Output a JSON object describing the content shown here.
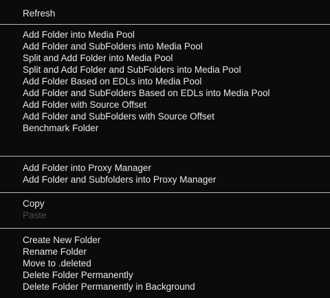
{
  "context_menu": {
    "groups": [
      {
        "items": [
          {
            "label": "Refresh",
            "enabled": true
          }
        ]
      },
      {
        "items": [
          {
            "label": "Add Folder into Media Pool",
            "enabled": true
          },
          {
            "label": "Add Folder and SubFolders into Media Pool",
            "enabled": true
          },
          {
            "label": "Split and Add Folder into Media Pool",
            "enabled": true
          },
          {
            "label": "Split and Add Folder and SubFolders into Media Pool",
            "enabled": true
          },
          {
            "label": "Add Folder Based on EDLs into Media Pool",
            "enabled": true
          },
          {
            "label": "Add Folder and SubFolders Based on EDLs into Media Pool",
            "enabled": true
          },
          {
            "label": "Add Folder with Source Offset",
            "enabled": true
          },
          {
            "label": "Add Folder and SubFolders with Source Offset",
            "enabled": true
          },
          {
            "label": "Benchmark Folder",
            "enabled": true
          }
        ]
      },
      {
        "items": [
          {
            "label": "Add Folder into Proxy Manager",
            "enabled": true
          },
          {
            "label": "Add Folder and Subfolders into Proxy Manager",
            "enabled": true
          }
        ]
      },
      {
        "items": [
          {
            "label": "Copy",
            "enabled": true
          },
          {
            "label": "Paste",
            "enabled": false
          }
        ]
      },
      {
        "items": [
          {
            "label": "Create New Folder",
            "enabled": true
          },
          {
            "label": "Rename Folder",
            "enabled": true
          },
          {
            "label": "Move to .deleted",
            "enabled": true
          },
          {
            "label": "Delete Folder Permanently",
            "enabled": true
          },
          {
            "label": "Delete Folder Permanently in Background",
            "enabled": true
          }
        ]
      }
    ],
    "colors": {
      "background": "#0b0b0b",
      "text": "#e8e8e8",
      "disabled_text": "#4b4b4b",
      "separator": "#bdbdbd"
    }
  }
}
